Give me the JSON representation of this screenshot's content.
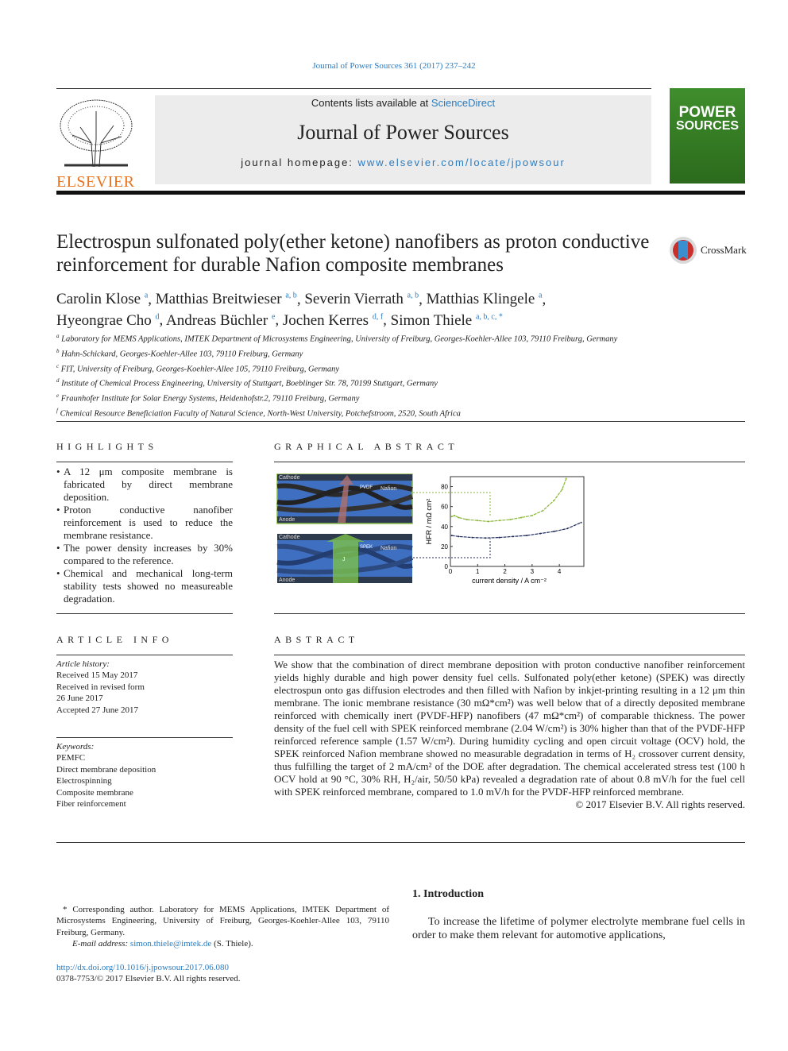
{
  "citation": "Journal of Power Sources 361 (2017) 237–242",
  "header": {
    "contents_prefix": "Contents lists available at ",
    "contents_link": "ScienceDirect",
    "journal": "Journal of Power Sources",
    "homepage_prefix": "journal homepage: ",
    "homepage_url": "www.elsevier.com/locate/jpowsour",
    "publisher": "ELSEVIER",
    "cover_title_1": "POWER",
    "cover_title_2": "SOURCES",
    "crossmark": "CrossMark"
  },
  "title": "Electrospun sulfonated poly(ether ketone) nanofibers as proton conductive reinforcement for durable Nafion composite membranes",
  "authors": [
    {
      "name": "Carolin Klose",
      "aff": "a"
    },
    {
      "name": "Matthias Breitwieser",
      "aff": "a, b"
    },
    {
      "name": "Severin Vierrath",
      "aff": "a, b"
    },
    {
      "name": "Matthias Klingele",
      "aff": "a"
    },
    {
      "name": "Hyeongrae Cho",
      "aff": "d"
    },
    {
      "name": "Andreas Büchler",
      "aff": "e"
    },
    {
      "name": "Jochen Kerres",
      "aff": "d, f"
    },
    {
      "name": "Simon Thiele",
      "aff": "a, b, c, *"
    }
  ],
  "affiliations": [
    {
      "k": "a",
      "t": "Laboratory for MEMS Applications, IMTEK Department of Microsystems Engineering, University of Freiburg, Georges-Koehler-Allee 103, 79110 Freiburg, Germany"
    },
    {
      "k": "b",
      "t": "Hahn-Schickard, Georges-Koehler-Allee 103, 79110 Freiburg, Germany"
    },
    {
      "k": "c",
      "t": "FIT, University of Freiburg, Georges-Koehler-Allee 105, 79110 Freiburg, Germany"
    },
    {
      "k": "d",
      "t": "Institute of Chemical Process Engineering, University of Stuttgart, Boeblinger Str. 78, 70199 Stuttgart, Germany"
    },
    {
      "k": "e",
      "t": "Fraunhofer Institute for Solar Energy Systems, Heidenhofstr.2, 79110 Freiburg, Germany"
    },
    {
      "k": "f",
      "t": "Chemical Resource Beneficiation Faculty of Natural Science, North-West University, Potchefstroom, 2520, South Africa"
    }
  ],
  "highlights": {
    "heading": "HIGHLIGHTS",
    "items": [
      "A 12 μm composite membrane is fabricated by direct membrane deposition.",
      "Proton conductive nanofiber reinforcement is used to reduce the membrane resistance.",
      "The power density increases by 30% compared to the reference.",
      "Chemical and mechanical long-term stability tests showed no measureable degradation."
    ]
  },
  "graphical_abstract": {
    "heading": "GRAPHICAL ABSTRACT",
    "panel_top": {
      "cathode": "Cathode",
      "anode": "Anode",
      "nafion": "Nafion",
      "fiber": "PVDF"
    },
    "panel_bottom": {
      "cathode": "Cathode",
      "anode": "Anode",
      "nafion": "Nafion",
      "fiber": "SPEK",
      "arrow": "J"
    },
    "colors": {
      "green": "#8ab63a",
      "navy": "#1e2a5a",
      "membrane": "#3f6fc0"
    }
  },
  "chart_data": {
    "type": "line",
    "xlabel": "current density / A cm⁻²",
    "ylabel": "HFR / mΩ cm²",
    "xlim": [
      0,
      4.9
    ],
    "ylim": [
      0,
      90
    ],
    "xticks": [
      "0",
      "1",
      "2",
      "3",
      "4"
    ],
    "yticks": [
      "0",
      "20",
      "40",
      "60",
      "80"
    ],
    "grid": false,
    "series": [
      {
        "color": "#8ab63a",
        "x": [
          0.05,
          0.15,
          0.3,
          0.6,
          1.0,
          1.4,
          1.8,
          2.2,
          2.6,
          3.0,
          3.4,
          3.8,
          4.1,
          4.25
        ],
        "y": [
          50,
          51,
          49,
          47,
          46,
          45,
          46,
          47,
          49,
          51,
          56,
          66,
          77,
          88
        ]
      },
      {
        "color": "#1e2a5a",
        "x": [
          0.05,
          0.3,
          0.8,
          1.3,
          1.8,
          2.3,
          2.8,
          3.3,
          3.8,
          4.3,
          4.8
        ],
        "y": [
          31,
          30,
          29,
          28.5,
          29,
          30,
          31,
          33,
          35,
          38,
          44
        ]
      }
    ]
  },
  "article_info": {
    "heading": "ARTICLE INFO",
    "history_label": "Article history:",
    "history": [
      "Received 15 May 2017",
      "Received in revised form",
      "26 June 2017",
      "Accepted 27 June 2017"
    ],
    "keywords_label": "Keywords:",
    "keywords": [
      "PEMFC",
      "Direct membrane deposition",
      "Electrospinning",
      "Composite membrane",
      "Fiber reinforcement"
    ]
  },
  "abstract": {
    "heading": "ABSTRACT",
    "text": "We show that the combination of direct membrane deposition with proton conductive nanofiber reinforcement yields highly durable and high power density fuel cells. Sulfonated poly(ether ketone) (SPEK) was directly electrospun onto gas diffusion electrodes and then filled with Nafion by inkjet-printing resulting in a 12 μm thin membrane. The ionic membrane resistance (30 mΩ*cm²) was well below that of a directly deposited membrane reinforced with chemically inert (PVDF-HFP) nanofibers (47 mΩ*cm²) of comparable thickness. The power density of the fuel cell with SPEK reinforced membrane (2.04 W/cm²) is 30% higher than that of the PVDF-HFP reinforced reference sample (1.57 W/cm²). During humidity cycling and open circuit voltage (OCV) hold, the SPEK reinforced Nafion membrane showed no measurable degradation in terms of H₂ crossover current density, thus fulfilling the target of 2 mA/cm² of the DOE after degradation. The chemical accelerated stress test (100 h OCV hold at 90 °C, 30% RH, H₂/air, 50/50 kPa) revealed a degradation rate of about 0.8 mV/h for the fuel cell with SPEK reinforced membrane, compared to 1.0 mV/h for the PVDF-HFP reinforced membrane.",
    "copyright": "© 2017 Elsevier B.V. All rights reserved."
  },
  "footnote": {
    "corresponding": "* Corresponding author. Laboratory for MEMS Applications, IMTEK Department of Microsystems Engineering, University of Freiburg, Georges-Koehler-Allee 103, 79110 Freiburg, Germany.",
    "email_label": "E-mail address: ",
    "email": "simon.thiele@imtek.de",
    "email_suffix": " (S. Thiele).",
    "doi": "http://dx.doi.org/10.1016/j.jpowsour.2017.06.080",
    "issn": "0378-7753/© 2017 Elsevier B.V. All rights reserved."
  },
  "intro": {
    "heading": "1.  Introduction",
    "text": "To increase the lifetime of polymer electrolyte membrane fuel cells in order to make them relevant for automotive applications,"
  }
}
